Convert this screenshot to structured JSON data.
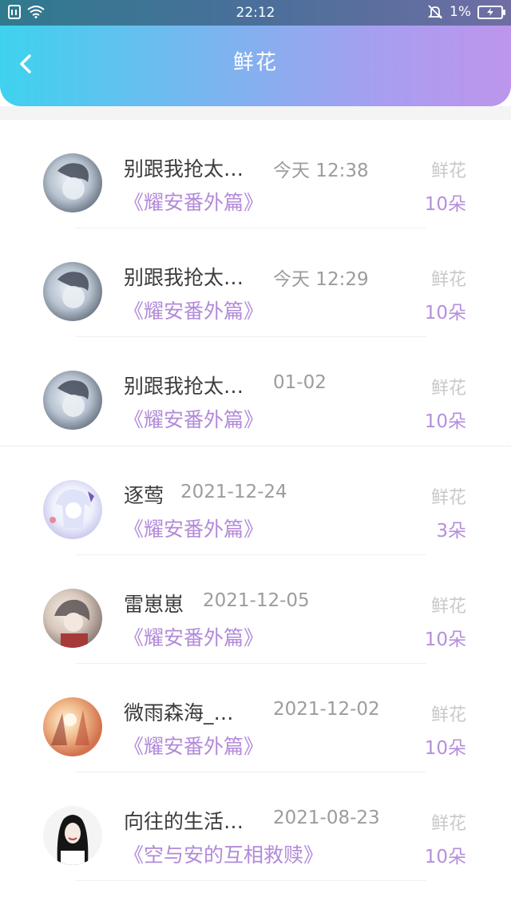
{
  "status_bar": {
    "time": "22:12",
    "battery": "1%"
  },
  "header": {
    "title": "鲜花",
    "back_icon": "chevron-left-icon"
  },
  "items": [
    {
      "name": "别跟我抢太…",
      "time": "今天 12:38",
      "book": "《耀安番外篇》",
      "label": "鲜花",
      "count": "10朵"
    },
    {
      "name": "别跟我抢太…",
      "time": "今天 12:29",
      "book": "《耀安番外篇》",
      "label": "鲜花",
      "count": "10朵"
    },
    {
      "name": "别跟我抢太…",
      "time": "01-02",
      "book": "《耀安番外篇》",
      "label": "鲜花",
      "count": "10朵"
    },
    {
      "name": "逐莺",
      "time": "2021-12-24",
      "book": "《耀安番外篇》",
      "label": "鲜花",
      "count": "3朵"
    },
    {
      "name": "雷崽崽",
      "time": "2021-12-05",
      "book": "《耀安番外篇》",
      "label": "鲜花",
      "count": "10朵"
    },
    {
      "name": "微雨森海_…",
      "time": "2021-12-02",
      "book": "《耀安番外篇》",
      "label": "鲜花",
      "count": "10朵"
    },
    {
      "name": "向往的生活…",
      "time": "2021-08-23",
      "book": "《空与安的互相救赎》",
      "label": "鲜花",
      "count": "10朵"
    }
  ]
}
